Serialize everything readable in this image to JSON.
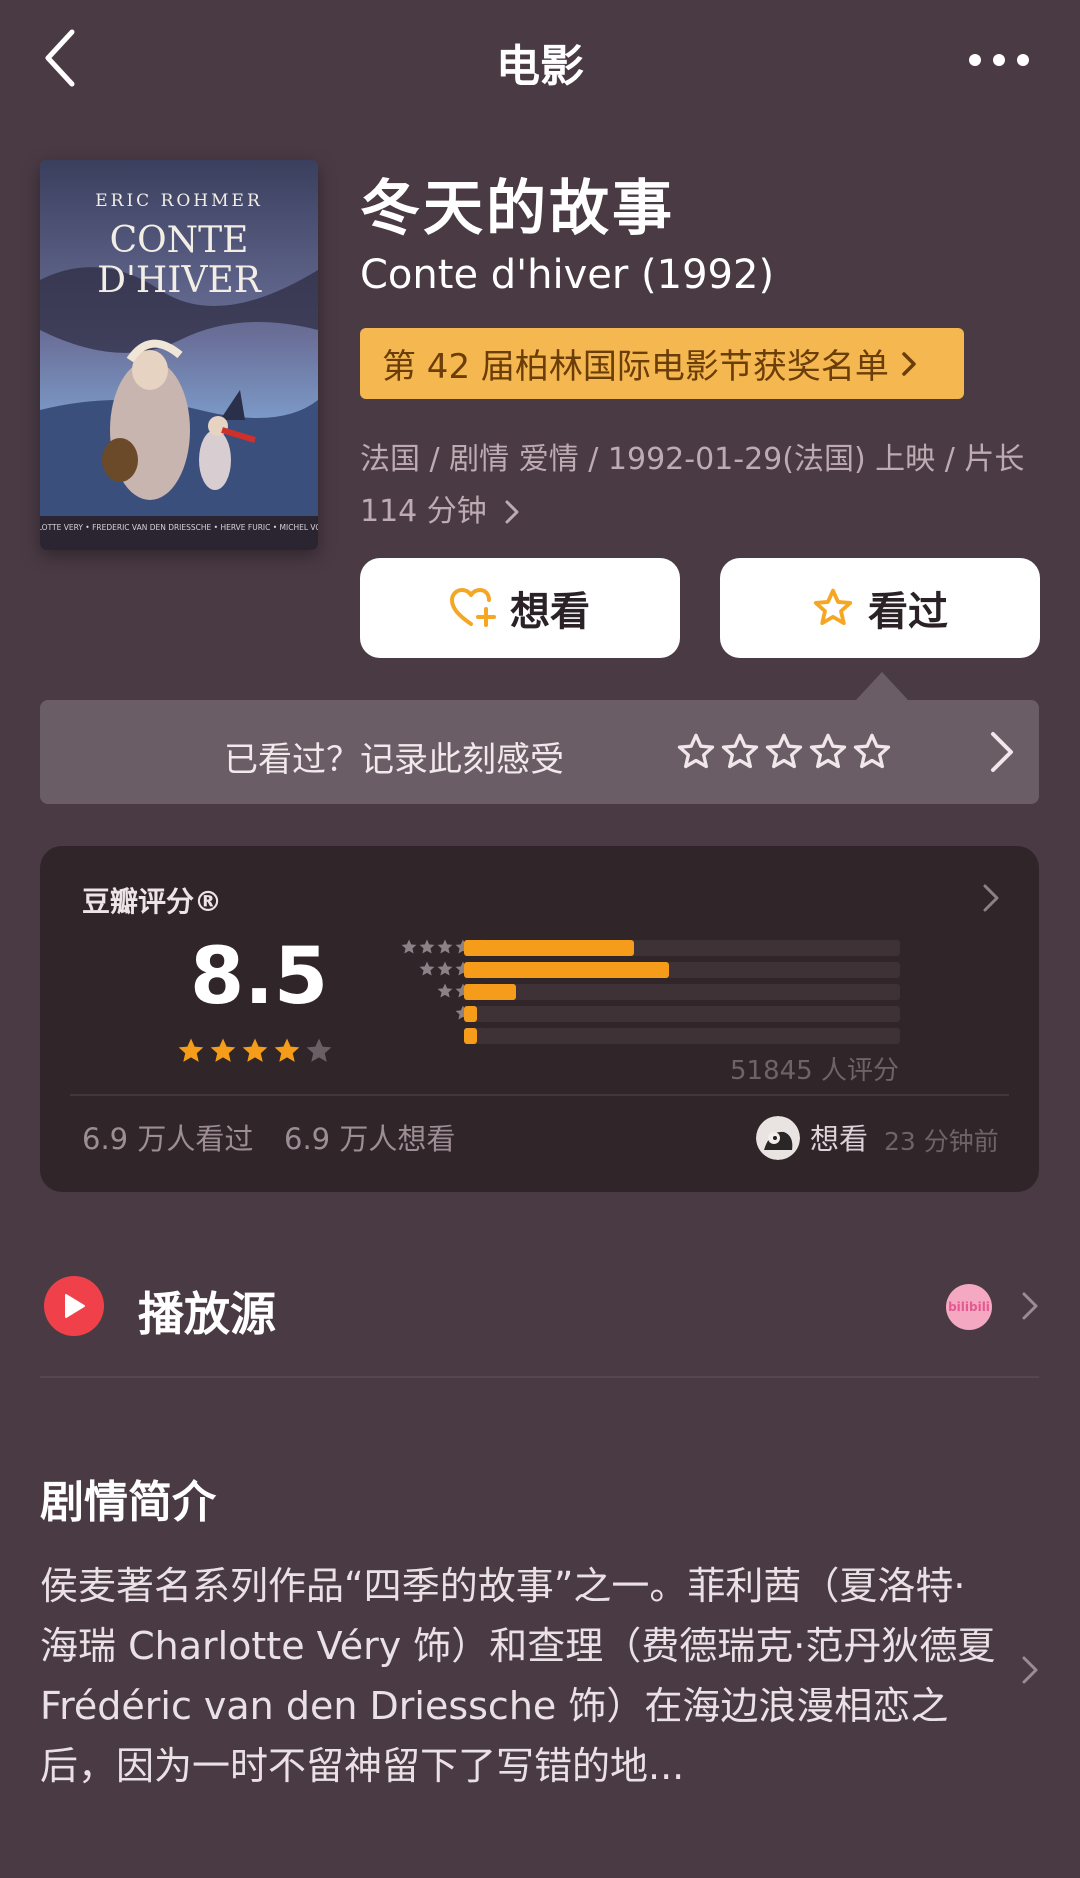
{
  "header": {
    "title": "电影"
  },
  "movie": {
    "title_cn": "冬天的故事",
    "title_en": "Conte d'hiver (1992)",
    "award": "第 42 届柏林国际电影节获奖名单",
    "meta": "法国 / 剧情 爱情 / 1992-01-29(法国) 上映 / 片长 114 分钟",
    "poster": {
      "director": "ERIC ROHMER",
      "title_line1": "CONTE",
      "title_line2": "D'HIVER",
      "credits": "CHARLOTTE VERY • FREDERIC VAN DEN DRIESSCHE • HERVE FURIC • MICHEL VOLETTI"
    }
  },
  "actions": {
    "want_label": "想看",
    "seen_label": "看过"
  },
  "record": {
    "prompt": "已看过？记录此刻感受",
    "star_count": 5
  },
  "rating": {
    "label": "豆瓣评分®",
    "score": "8.5",
    "score_stars": 4.25,
    "distribution": [
      {
        "stars": 5,
        "fraction": 0.39
      },
      {
        "stars": 4,
        "fraction": 0.47
      },
      {
        "stars": 3,
        "fraction": 0.12
      },
      {
        "stars": 2,
        "fraction": 0.03
      },
      {
        "stars": 1,
        "fraction": 0.03
      }
    ],
    "count": "51845 人评分",
    "seen_count": "6.9 万人看过",
    "want_count": "6.9 万人想看",
    "friend_action": "想看",
    "friend_time": "23 分钟前"
  },
  "play": {
    "title": "播放源",
    "provider_icon": "bilibili",
    "provider_text": "bilibili"
  },
  "synopsis": {
    "title": "剧情简介",
    "text": "侯麦著名系列作品“四季的故事”之一。菲利茜（夏洛特·海瑞 Charlotte Véry 饰）和查理（费德瑞克·范丹狄德夏 Frédéric van den Driessche 饰）在海边浪漫相恋之后，因为一时不留神留下了写错的地..."
  },
  "colors": {
    "background": "#4a3a44",
    "award_badge": "#f5b850",
    "accent_star": "#f59c1a",
    "play_red": "#f0414b",
    "card": "#302529"
  }
}
